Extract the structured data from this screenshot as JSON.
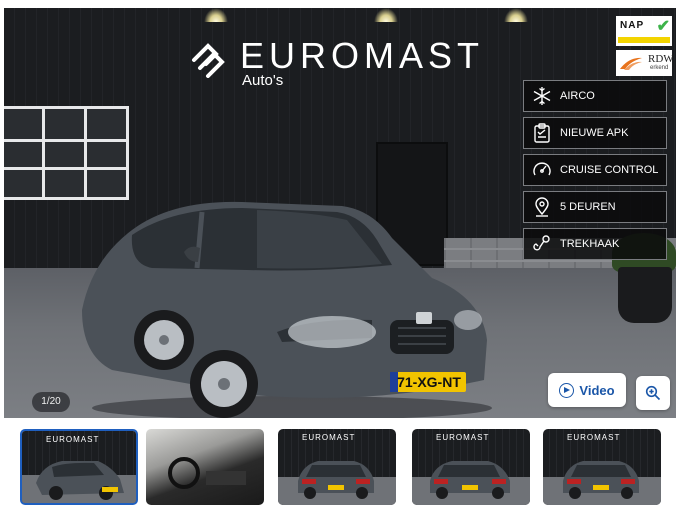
{
  "brand": {
    "name": "EUROMAST",
    "subtitle": "Auto's"
  },
  "badges": {
    "nap": "NAP",
    "rdw_title": "RDW",
    "rdw_sub": "erkend"
  },
  "features": [
    {
      "label": "AIRCO",
      "icon": "snowflake-icon"
    },
    {
      "label": "NIEUWE APK",
      "icon": "clipboard-check-icon"
    },
    {
      "label": "CRUISE CONTROL",
      "icon": "speedometer-icon"
    },
    {
      "label": "5 DEUREN",
      "icon": "location-pin-icon"
    },
    {
      "label": "TREKHAAK",
      "icon": "tow-hook-icon"
    }
  ],
  "car": {
    "plate": "71-XG-NT",
    "color": "#4b5158"
  },
  "gallery": {
    "counter": "1/20",
    "video_label": "Video",
    "thumb_logo": "EUROMAST"
  },
  "colors": {
    "accent": "#1a56a8",
    "active_border": "#1f5fbf"
  }
}
